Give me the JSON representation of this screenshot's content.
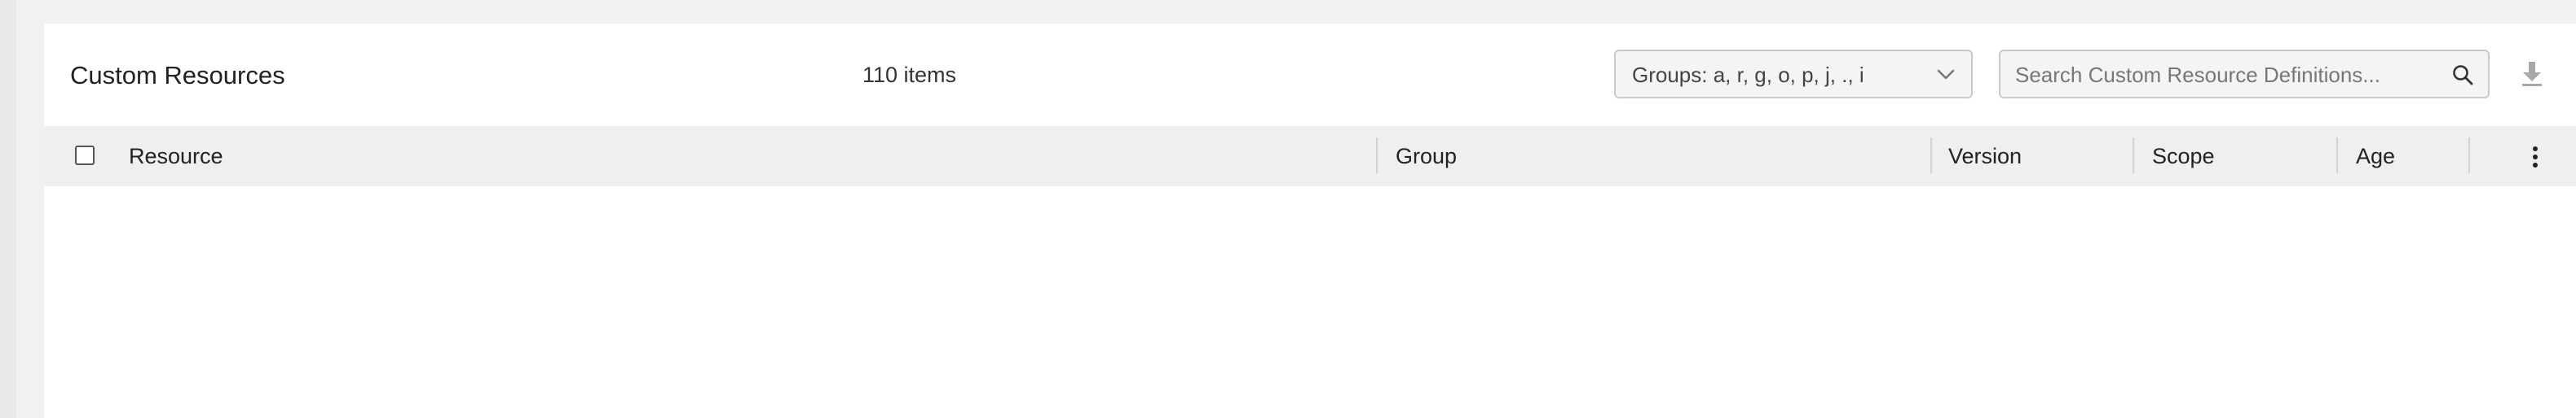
{
  "panel": {
    "title": "Custom Resources",
    "item_count": "110 items"
  },
  "filters": {
    "groups_label": "Groups: a, r, g, o, p, j, ., i",
    "search_placeholder": "Search Custom Resource Definitions..."
  },
  "table": {
    "columns": {
      "resource": "Resource",
      "group": "Group",
      "version": "Version",
      "scope": "Scope",
      "age": "Age"
    },
    "rows": []
  },
  "icons": {
    "chevron": "chevron-down-icon",
    "search": "search-icon",
    "download": "download-icon",
    "menu": "kebab-menu-icon"
  }
}
